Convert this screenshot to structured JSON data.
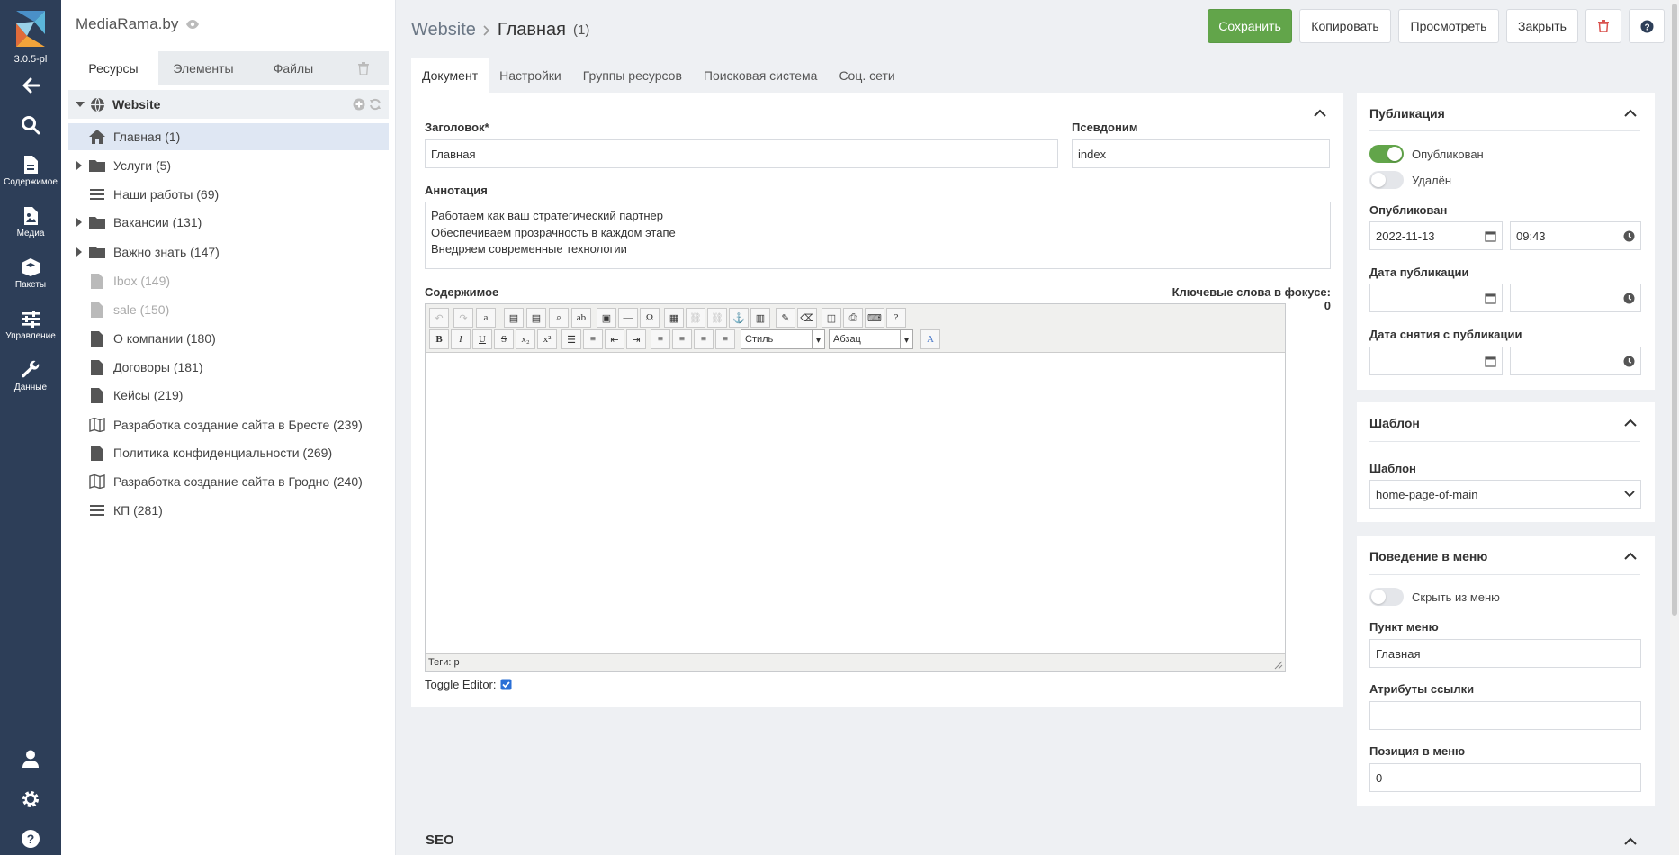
{
  "app": {
    "version": "3.0.5-pl"
  },
  "rail": {
    "items": [
      {
        "label": "",
        "icon": "back-arrow-icon"
      },
      {
        "label": "",
        "icon": "search-icon"
      },
      {
        "label": "Содержимое",
        "icon": "document-icon"
      },
      {
        "label": "Медиа",
        "icon": "media-icon"
      },
      {
        "label": "Пакеты",
        "icon": "package-icon"
      },
      {
        "label": "Управление",
        "icon": "sliders-icon"
      },
      {
        "label": "Данные",
        "icon": "wrench-icon"
      }
    ],
    "bottom": [
      "user-icon",
      "gear-icon",
      "help-icon"
    ]
  },
  "tree": {
    "site_name": "MediaRama.by",
    "tabs": [
      "Ресурсы",
      "Элементы",
      "Файлы"
    ],
    "root": "Website",
    "items": [
      {
        "label": "Главная (1)",
        "icon": "home-icon"
      },
      {
        "label": "Услуги (5)",
        "icon": "folder-icon"
      },
      {
        "label": "Наши работы (69)",
        "icon": "list-icon"
      },
      {
        "label": "Вакансии (131)",
        "icon": "folder-icon"
      },
      {
        "label": "Важно знать (147)",
        "icon": "folder-icon"
      },
      {
        "label": "Ibox (149)",
        "icon": "file-icon"
      },
      {
        "label": "sale (150)",
        "icon": "file-icon"
      },
      {
        "label": "О компании (180)",
        "icon": "file-icon"
      },
      {
        "label": "Договоры (181)",
        "icon": "file-icon"
      },
      {
        "label": "Кейсы (219)",
        "icon": "file-icon"
      },
      {
        "label": "Разработка создание сайта в Бресте (239)",
        "icon": "map-icon"
      },
      {
        "label": "Политика конфиденциальности (269)",
        "icon": "file-icon"
      },
      {
        "label": "Разработка создание сайта в Гродно (240)",
        "icon": "map-icon"
      },
      {
        "label": "КП (281)",
        "icon": "list-icon"
      }
    ]
  },
  "header": {
    "crumb_root": "Website",
    "title": "Главная",
    "id": "(1)",
    "buttons": {
      "save": "Сохранить",
      "copy": "Копировать",
      "view": "Просмотреть",
      "close": "Закрыть"
    }
  },
  "doc_tabs": [
    "Документ",
    "Настройки",
    "Группы ресурсов",
    "Поисковая система",
    "Соц. сети"
  ],
  "form": {
    "title_label": "Заголовок*",
    "title_value": "Главная",
    "alias_label": "Псевдоним",
    "alias_value": "index",
    "annotation_label": "Аннотация",
    "annotation_lines": [
      "Работаем как ваш стратегический партнер",
      "Обеспечиваем прозрачность в каждом этапе",
      "Внедряем современные технологии"
    ],
    "content_label": "Содержимое",
    "keywords": "Ключевые слова в фокусе: 0",
    "editor": {
      "style_select": "Стиль",
      "format_select": "Абзац",
      "status": "Теги: p"
    },
    "toggle_editor": "Toggle Editor:"
  },
  "publication": {
    "heading": "Публикация",
    "published_toggle": "Опубликован",
    "deleted_toggle": "Удалён",
    "published_label": "Опубликован",
    "date": "2022-11-13",
    "time": "09:43",
    "pub_date_label": "Дата публикации",
    "unpub_date_label": "Дата снятия с публикации"
  },
  "template": {
    "heading": "Шаблон",
    "label": "Шаблон",
    "value": "home-page-of-main"
  },
  "menu": {
    "heading": "Поведение в меню",
    "hide_toggle": "Скрыть из меню",
    "item_label": "Пункт меню",
    "item_value": "Главная",
    "attrs_label": "Атрибуты ссылки",
    "attrs_value": "",
    "pos_label": "Позиция в меню",
    "pos_value": "0"
  },
  "seo": {
    "heading": "SEO"
  },
  "colors": {
    "rail": "#2d3e58",
    "primary": "#62a54a",
    "selected": "#dfe7f3",
    "danger": "#d9534f"
  }
}
